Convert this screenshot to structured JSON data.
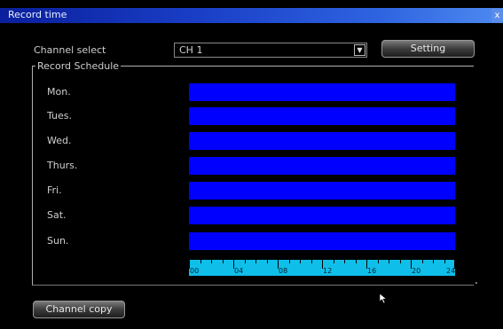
{
  "window": {
    "title": "Record time",
    "close_label": "x"
  },
  "form": {
    "channel_label": "Channel select",
    "channel_value": "CH 1",
    "setting_label": "Setting"
  },
  "schedule": {
    "group_title": "Record Schedule",
    "days": [
      {
        "label": "Mon.",
        "recording": true
      },
      {
        "label": "Tues.",
        "recording": true
      },
      {
        "label": "Wed.",
        "recording": true
      },
      {
        "label": "Thurs.",
        "recording": true
      },
      {
        "label": "Fri.",
        "recording": true
      },
      {
        "label": "Sat.",
        "recording": true
      },
      {
        "label": "Sun.",
        "recording": true
      }
    ],
    "bar_color": "#0000ff",
    "timeline_color": "#0fbfe9",
    "hour_labels": [
      "00",
      "04",
      "08",
      "12",
      "16",
      "20",
      "24"
    ]
  },
  "footer": {
    "copy_label": "Channel copy"
  }
}
